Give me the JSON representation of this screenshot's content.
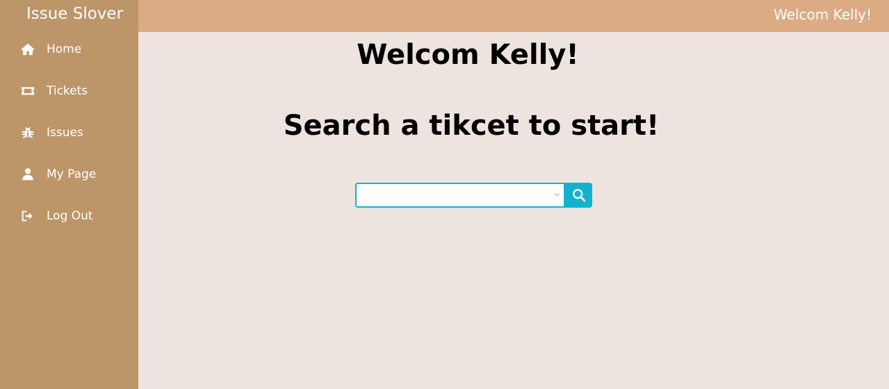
{
  "app": {
    "brand": "Issue Slover"
  },
  "header": {
    "greeting": "Welcom Kelly!"
  },
  "sidebar": {
    "items": [
      {
        "label": "Home",
        "icon": "home-icon"
      },
      {
        "label": "Tickets",
        "icon": "ticket-icon"
      },
      {
        "label": "Issues",
        "icon": "bug-icon"
      },
      {
        "label": "My Page",
        "icon": "user-icon"
      },
      {
        "label": "Log Out",
        "icon": "logout-icon"
      }
    ]
  },
  "main": {
    "welcome": "Welcom Kelly!",
    "prompt": "Search a tikcet to start!",
    "search": {
      "value": "",
      "placeholder": "",
      "button_icon": "search-icon"
    }
  },
  "colors": {
    "sidebar": "#bc9669",
    "topbar": "#dbab84",
    "background": "#ede3df",
    "accent": "#13b3ce"
  }
}
